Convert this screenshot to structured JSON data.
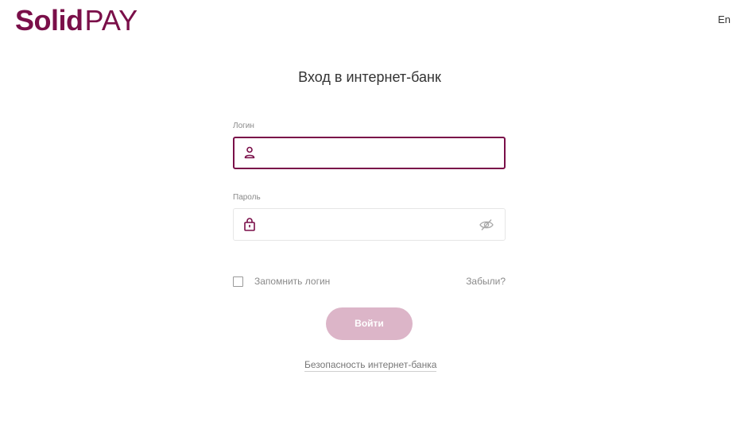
{
  "header": {
    "logo_bold": "Solid",
    "logo_light": "PAY",
    "language": "En"
  },
  "form": {
    "title": "Вход в интернет-банк",
    "login": {
      "label": "Логин",
      "value": "",
      "icon": "user-icon"
    },
    "password": {
      "label": "Пароль",
      "value": "",
      "icon": "lock-icon",
      "toggle_icon": "eye-hidden-icon"
    },
    "remember_label": "Запомнить логин",
    "remember_checked": false,
    "forgot_label": "Забыли?",
    "submit_label": "Войти",
    "security_link": "Безопасность интернет-банка"
  },
  "colors": {
    "brand": "#7a0f49",
    "button_disabled": "#dcb5c8",
    "muted_text": "#8a8a8a"
  }
}
